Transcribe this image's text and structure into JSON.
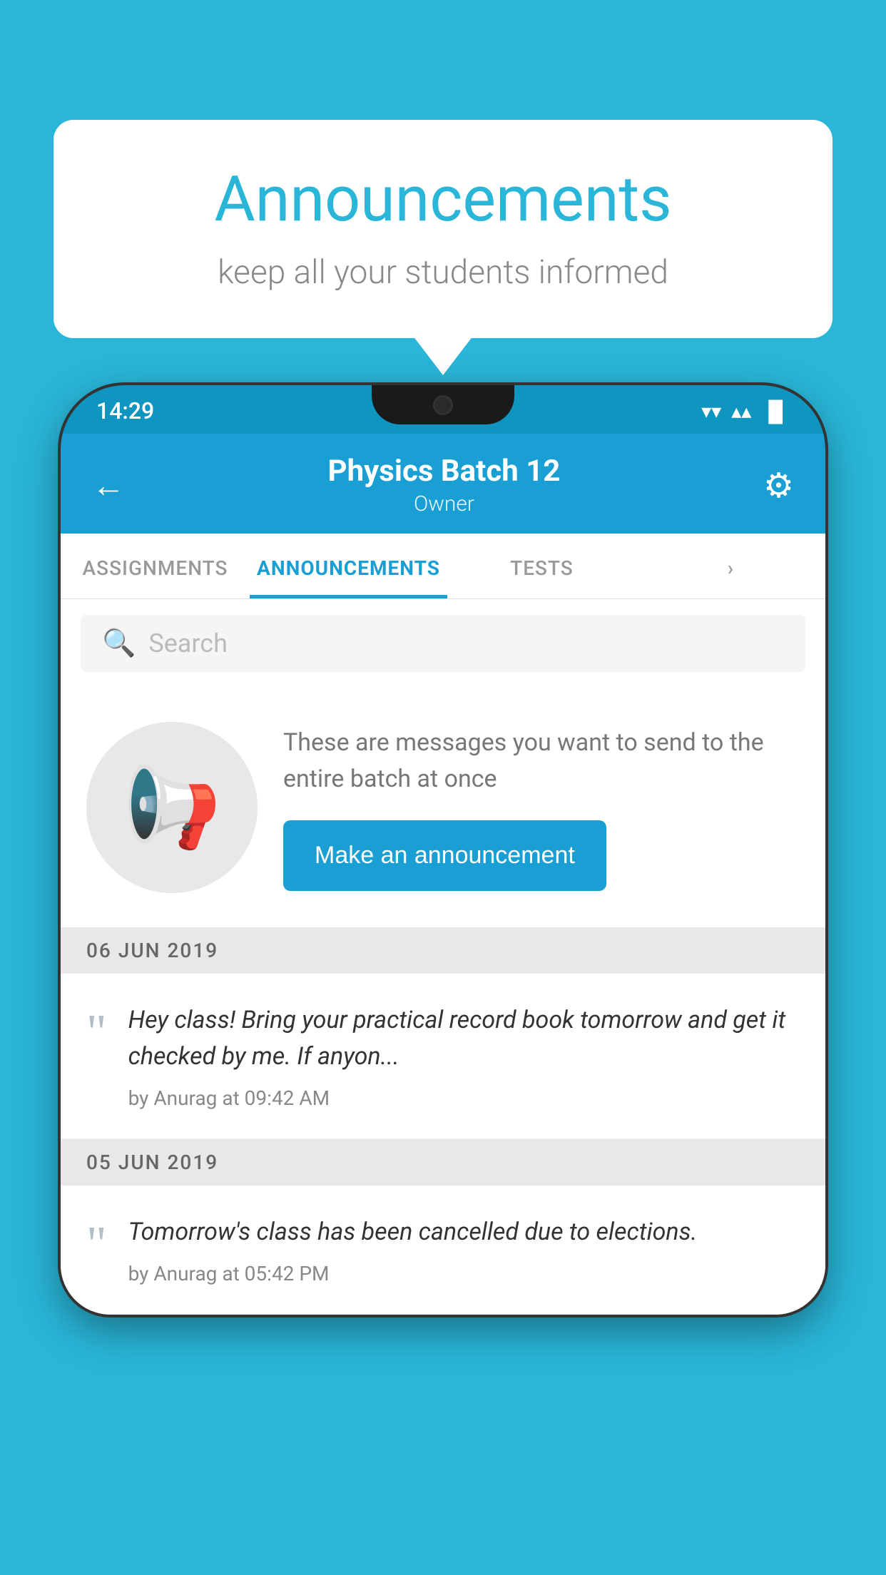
{
  "bubble": {
    "title": "Announcements",
    "subtitle": "keep all your students informed"
  },
  "status_bar": {
    "time": "14:29",
    "wifi_icon": "▾",
    "signal_icon": "▴",
    "battery_icon": "▐"
  },
  "header": {
    "back_icon": "←",
    "title": "Physics Batch 12",
    "subtitle": "Owner",
    "gear_icon": "⚙"
  },
  "tabs": [
    {
      "label": "ASSIGNMENTS",
      "active": false
    },
    {
      "label": "ANNOUNCEMENTS",
      "active": true
    },
    {
      "label": "TESTS",
      "active": false
    },
    {
      "label": "·",
      "active": false
    }
  ],
  "search": {
    "placeholder": "Search"
  },
  "placeholder": {
    "text": "These are messages you want to send to the entire batch at once",
    "button_label": "Make an announcement"
  },
  "announcements": [
    {
      "date": "06  JUN  2019",
      "body": "Hey class! Bring your practical record book tomorrow and get it checked by me. If anyon...",
      "meta": "by Anurag at 09:42 AM"
    },
    {
      "date": "05  JUN  2019",
      "body": "Tomorrow's class has been cancelled due to elections.",
      "meta": "by Anurag at 05:42 PM"
    }
  ]
}
